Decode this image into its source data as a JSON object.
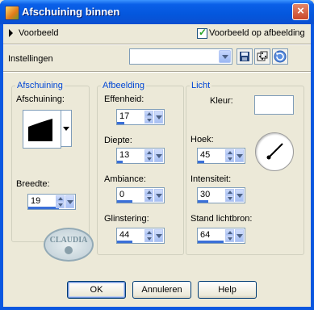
{
  "window": {
    "title": "Afschuining binnen",
    "close_glyph": "×"
  },
  "preview": {
    "label": "Voorbeeld",
    "checkbox_label": "Voorbeeld op afbeelding",
    "checked": true
  },
  "settings": {
    "label": "Instellingen",
    "value": ""
  },
  "groups": {
    "afschuining": {
      "legend": "Afschuining",
      "shape_label": "Afschuining:",
      "width_label": "Breedte:",
      "width_value": "19"
    },
    "afbeelding": {
      "legend": "Afbeelding",
      "fields": [
        {
          "label": "Effenheid:",
          "value": "17"
        },
        {
          "label": "Diepte:",
          "value": "13"
        },
        {
          "label": "Ambiance:",
          "value": "0"
        },
        {
          "label": "Glinstering:",
          "value": "44"
        }
      ]
    },
    "licht": {
      "legend": "Licht",
      "color_label": "Kleur:",
      "color_value": "#ffffff",
      "fields": [
        {
          "label": "Hoek:",
          "value": "45"
        },
        {
          "label": "Intensiteit:",
          "value": "30"
        },
        {
          "label": "Stand lichtbron:",
          "value": "64"
        }
      ]
    }
  },
  "watermark": {
    "text": "CLAUDIA"
  },
  "buttons": {
    "ok": "OK",
    "cancel": "Annuleren",
    "help": "Help"
  }
}
